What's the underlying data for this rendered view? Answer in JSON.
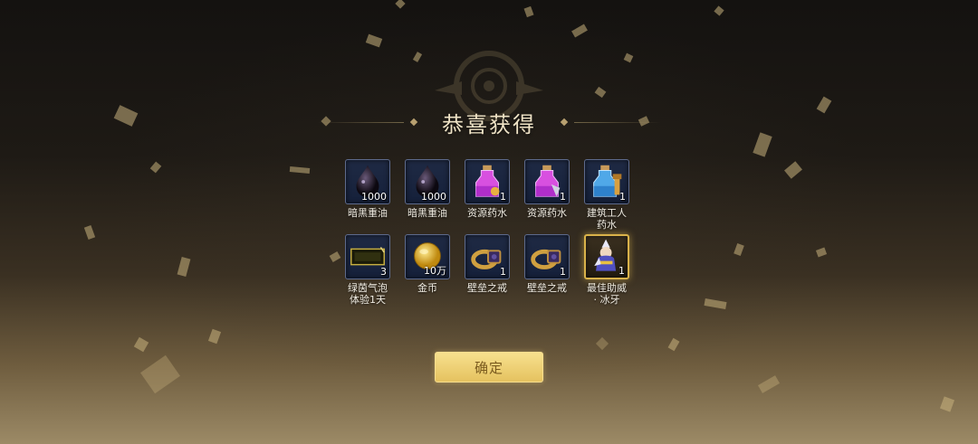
{
  "dialog": {
    "title": "恭喜获得",
    "confirm_label": "确定"
  },
  "rewards": [
    {
      "name": "暗黑重油",
      "qty": "1000",
      "icon": "dark-oil-icon"
    },
    {
      "name": "暗黑重油",
      "qty": "1000",
      "icon": "dark-oil-icon"
    },
    {
      "name": "资源药水",
      "qty": "1",
      "icon": "resource-potion-icon"
    },
    {
      "name": "资源药水",
      "qty": "1",
      "icon": "resource-potion-icon"
    },
    {
      "name": "建筑工人\n药水",
      "qty": "1",
      "icon": "builder-potion-icon"
    },
    {
      "name": "绿茵气泡\n体验1天",
      "qty": "3",
      "icon": "bubble-scenery-icon"
    },
    {
      "name": "金币",
      "qty": "10万",
      "icon": "gold-coin-icon"
    },
    {
      "name": "壁垒之戒",
      "qty": "1",
      "icon": "ring-icon"
    },
    {
      "name": "壁垒之戒",
      "qty": "1",
      "icon": "ring-icon"
    },
    {
      "name": "最佳助威\n· 冰牙",
      "qty": "1",
      "icon": "mascot-icon"
    }
  ],
  "colors": {
    "accent_gold": "#d9b24a",
    "slot_border": "#5d6a8c",
    "button_text": "#7a5a1e"
  }
}
